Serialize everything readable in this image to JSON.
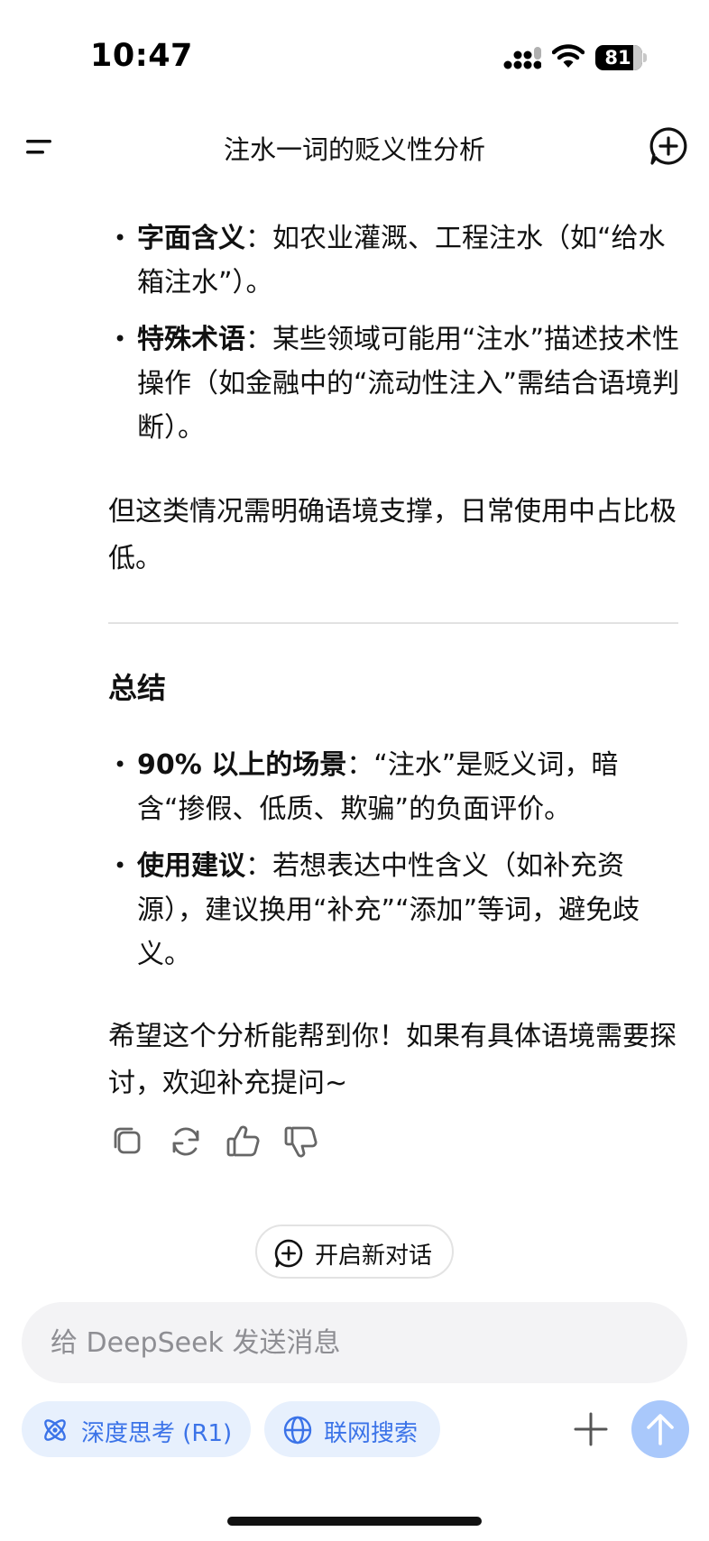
{
  "status": {
    "time": "10:47",
    "battery": "81",
    "battery_level": 0.81
  },
  "nav": {
    "title": "注水一词的贬义性分析"
  },
  "sections": {
    "bullets_top": [
      {
        "term": "字面含义",
        "text": "：如农业灌溉、工程注水（如“给水箱注水”）。"
      },
      {
        "term": "特殊术语",
        "text": "：某些领域可能用“注水”描述技术性操作（如金融中的“流动性注入”需结合语境判断）。"
      }
    ],
    "para1": "但这类情况需明确语境支撑，日常使用中占比极低。",
    "summary_title": "总结",
    "bullets_summary": [
      {
        "term": "90% 以上的场景",
        "text": "：“注水”是贬义词，暗含“掺假、低质、欺骗”的负面评价。"
      },
      {
        "term": "使用建议",
        "text": "：若想表达中性含义（如补充资源），建议换用“补充”“添加”等词，避免歧义。"
      }
    ],
    "closing": "希望这个分析能帮到你！如果有具体语境需要探讨，欢迎补充提问~"
  },
  "actions": {
    "icons": [
      "copy-icon",
      "regenerate-icon",
      "thumbs-up-icon",
      "thumbs-down-icon"
    ]
  },
  "new_chat_label": "开启新对话",
  "composer": {
    "placeholder": "给 DeepSeek 发送消息",
    "deep_think_label": "深度思考 (R1)",
    "web_search_label": "联网搜索"
  },
  "colors": {
    "accent": "#3b73e8",
    "chip_bg": "#e7f0fd",
    "send_bg": "#a9c8fb",
    "input_bg": "#f3f3f5"
  }
}
